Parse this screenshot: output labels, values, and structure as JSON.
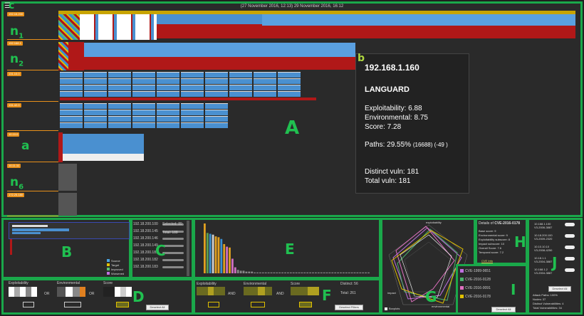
{
  "timeline": {
    "text": "(27 November 2016, 12:13) 29 November 2016, 16:12"
  },
  "hosts": [
    "192.16.200",
    "192.168.1",
    "131.10.0",
    "131.42.0",
    "10.10.0",
    "10.11.11",
    "172.25.180"
  ],
  "row_labels": {
    "n1": "n1",
    "n2": "n2",
    "a": "a",
    "n6": "n6"
  },
  "tooltip": {
    "letter": "b",
    "ip": "192.168.1.160",
    "name": "LANGUARD",
    "exploitability": "Exploitability: 6.88",
    "environmental": "Environmental: 8.75",
    "score": "Score: 7.28",
    "paths_main": "Paths: 29.55%",
    "paths_detail": "(16688) (-49 )",
    "distinct": "Distinct vuln: 181",
    "total": "Total vuln: 181"
  },
  "panel_labels": {
    "A": "A",
    "B": "B",
    "C": "C",
    "D": "D",
    "E": "E",
    "F": "F",
    "G": "G",
    "H": "H",
    "I": "I",
    "J": "J",
    "c": "c"
  },
  "legend": [
    "Source",
    "Target",
    "Improved",
    "Worsened"
  ],
  "legend_colors": [
    "#4aa3e0",
    "#e0c000",
    "#56c070",
    "#c070e0"
  ],
  "c_list": {
    "items": [
      "192.18.200.100",
      "192.18.200.145",
      "192.18.200.146",
      "192.18.200.149",
      "192.18.200.181",
      "192.18.200.182",
      "192.18.200.183"
    ],
    "selected": "Selected: 89",
    "total": "Total: 188"
  },
  "d_panel": {
    "exploitability": "Exploitability",
    "environmental": "Environmental",
    "score": "Score",
    "or1": "OR",
    "or2": "OR",
    "deselect": "Deselect All"
  },
  "f_panel": {
    "exploitability": "Exploitability",
    "environmental": "Environmental",
    "score": "Score",
    "and1": "AND",
    "and2": "AND",
    "distinct": "Distinct: 56",
    "total": "Total: 261",
    "deselect": "Deselect Filters"
  },
  "g_panel": {
    "axes": [
      "exploitability",
      "impact",
      "environmental"
    ],
    "boxplots": "Boxplots"
  },
  "h_panel": {
    "title_prefix": "Details of ",
    "cve": "CVE-2016-0178",
    "lines": [
      "Base score: 9",
      "Environmental score: 9",
      "Exploitability subscore: 8",
      "Impact subscore: 10",
      "Overall Score: 7.6",
      "Temporal score: 7.2"
    ],
    "link": "CVE Info"
  },
  "i_panel": {
    "items": [
      "CVE-1999-0651",
      "CVE-2016-0128",
      "CVE-2016-0091",
      "CVE-2016-0178"
    ],
    "colors": [
      "#c070e0",
      "#4ab06a",
      "#e070c0",
      "#e0c000"
    ],
    "deselect": "Deselect All"
  },
  "j_panel": {
    "items": [
      "10.168.1.100",
      "V3-2006-3887",
      "10.18.200.100",
      "V3-2009-2320",
      "10.10.10.10",
      "V3-2008-4250",
      "10.18.1.1",
      "V3-2004-3887",
      "10.168.1.2",
      "V3-2004-3887"
    ],
    "deselect": "Deselect All",
    "stats": [
      "Attack Paths: 100%",
      "Nodes: 37",
      "Distinct Vulnerabilities: 4",
      "Total Vulnerabilities: 34"
    ]
  },
  "e_chart": {
    "values": [
      58,
      47,
      46,
      45,
      43,
      42,
      40,
      34,
      31,
      30,
      17,
      7,
      4,
      3,
      3,
      2,
      2,
      2,
      1,
      1,
      1,
      1,
      1,
      1,
      1,
      1,
      1,
      1,
      1,
      1,
      1,
      1,
      1,
      1,
      1,
      1,
      1,
      1,
      1,
      1,
      1,
      1,
      1,
      1,
      1,
      1,
      1,
      1,
      1,
      1,
      1,
      1,
      1,
      1,
      1,
      1,
      1,
      1,
      1,
      1
    ],
    "colors": [
      "#e0a020",
      "#5aa050",
      "#3a8fd0",
      "#d0d0d0",
      "#e0a020",
      "#e0a020",
      "#3a8fd0",
      "#e0a020",
      "#d070c0",
      "#e0a020",
      "#d070c0",
      "#d070c0",
      "#888",
      "#888",
      "#888",
      "#888",
      "#888",
      "#888",
      "#888",
      "#888",
      "#888",
      "#888",
      "#888",
      "#888",
      "#888",
      "#888",
      "#888",
      "#888",
      "#888",
      "#888",
      "#888",
      "#888",
      "#888",
      "#888",
      "#888",
      "#888",
      "#888",
      "#888",
      "#888",
      "#888",
      "#888",
      "#888",
      "#888",
      "#888",
      "#888",
      "#888",
      "#888",
      "#888",
      "#888",
      "#888",
      "#888",
      "#888",
      "#888",
      "#888",
      "#888",
      "#888",
      "#888",
      "#888",
      "#888",
      "#888"
    ]
  },
  "colors": {
    "green": "#1aa84a",
    "orange": "#e8901a",
    "blue": "#4a90d0",
    "red": "#b01818",
    "lightblue": "#5aa0e0"
  }
}
